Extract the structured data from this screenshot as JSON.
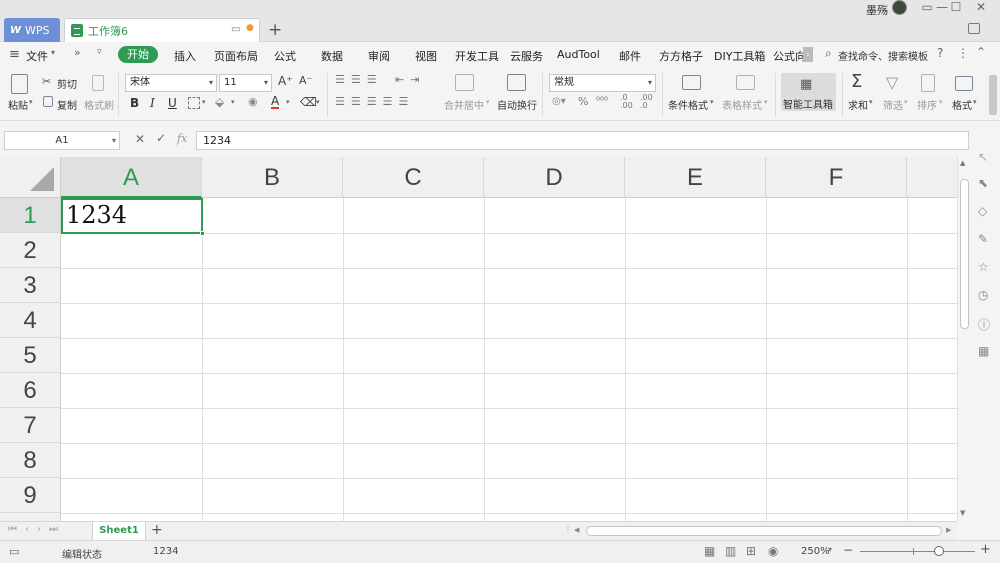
{
  "titlebar": {
    "app_tab": "WPS",
    "doc_tab": "工作簿6",
    "user_name": "墨殇"
  },
  "menu": {
    "file": "文件",
    "items": [
      "开始",
      "插入",
      "页面布局",
      "公式",
      "数据",
      "审阅",
      "视图",
      "开发工具",
      "云服务",
      "AudTool",
      "邮件",
      "方方格子",
      "DIY工具箱",
      "公式向"
    ],
    "search_placeholder": "查找命令、搜索模板"
  },
  "ribbon": {
    "cut": "剪切",
    "paste": "粘贴",
    "copy": "复制",
    "format_painter": "格式刷",
    "font_name": "宋体",
    "font_size": "11",
    "merge_center": "合并居中",
    "wrap_text": "自动换行",
    "number_format": "常规",
    "conditional_format": "条件格式",
    "table_style": "表格样式",
    "smart_toolbox": "智能工具箱",
    "sum": "求和",
    "filter": "筛选",
    "sort": "排序",
    "format": "格式"
  },
  "formula_bar": {
    "name_box": "A1",
    "fx": "fx",
    "value": "1234"
  },
  "grid": {
    "columns": [
      "A",
      "B",
      "C",
      "D",
      "E",
      "F"
    ],
    "rows": [
      "1",
      "2",
      "3",
      "4",
      "5",
      "6",
      "7",
      "8",
      "9"
    ],
    "cell_a1": "1234",
    "active_cell": "A1"
  },
  "sheets": {
    "tabs": [
      "Sheet1"
    ]
  },
  "statusbar": {
    "mode": "编辑状态",
    "value": "1234",
    "zoom": "250%"
  },
  "colors": {
    "accent": "#2e9b54",
    "wps_tab": "#6d8fd6"
  }
}
